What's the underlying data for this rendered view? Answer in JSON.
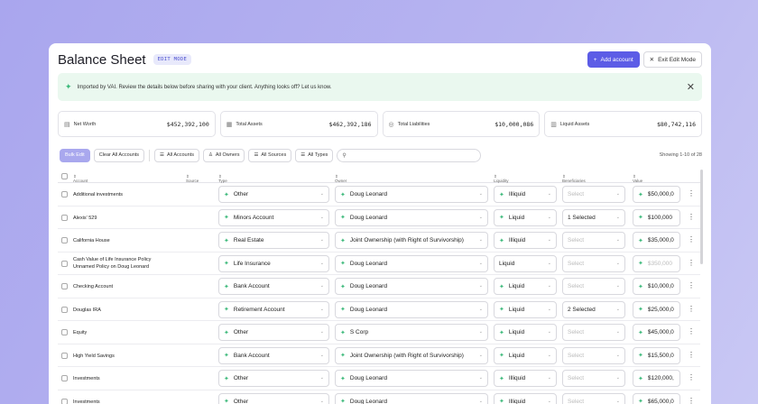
{
  "header": {
    "title": "Balance Sheet",
    "mode_badge": "EDIT MODE",
    "add_account_label": "Add account",
    "exit_edit_label": "Exit Edit Mode"
  },
  "banner": {
    "message": "Imported by VAI. Review the details below before sharing with your client. Anything looks off? Let us know."
  },
  "stats": [
    {
      "label": "Net Worth",
      "value": "$452,392,100"
    },
    {
      "label": "Total Assets",
      "value": "$462,392,186"
    },
    {
      "label": "Total Liabilities",
      "value": "$10,000,086"
    },
    {
      "label": "Liquid Assets",
      "value": "$80,742,116"
    }
  ],
  "filters": {
    "bulk_edit": "Bulk Edit",
    "clear_all": "Clear All Accounts",
    "all_accounts": "All Accounts",
    "all_owners": "All Owners",
    "all_sources": "All Sources",
    "all_types": "All Types",
    "showing": "Showing 1-10 of 28"
  },
  "columns": {
    "account": "Account",
    "source": "Source",
    "type": "Type",
    "owner": "Owner",
    "liquidity": "Liquidity",
    "beneficiaries": "Beneficiaries",
    "value": "Value"
  },
  "rows": [
    {
      "account": "Additional investments",
      "account2": "",
      "type": "Other",
      "owner": "Doug Leonard",
      "liquidity": "Illiquid",
      "beneficiaries": "Select",
      "value": "$50,000,0"
    },
    {
      "account": "Alexis' 529",
      "account2": "",
      "type": "Minors Account",
      "owner": "Doug Leonard",
      "liquidity": "Liquid",
      "beneficiaries": "1 Selected",
      "value": "$100,000"
    },
    {
      "account": "California House",
      "account2": "",
      "type": "Real Estate",
      "owner": "Joint Ownership (with Right of Survivorship)",
      "liquidity": "Illiquid",
      "beneficiaries": "Select",
      "value": "$35,000,0"
    },
    {
      "account": "Cash Value of Life Insurance Policy",
      "account2": "Unnamed Policy on Doug Leonard",
      "type": "Life Insurance",
      "owner": "Doug Leonard",
      "liquidity": "Liquid",
      "beneficiaries": "Select",
      "value": "$350,000"
    },
    {
      "account": "Checking Account",
      "account2": "",
      "type": "Bank Account",
      "owner": "Doug Leonard",
      "liquidity": "Liquid",
      "beneficiaries": "Select",
      "value": "$10,000,0"
    },
    {
      "account": "Douglas IRA",
      "account2": "",
      "type": "Retirement Account",
      "owner": "Doug Leonard",
      "liquidity": "Liquid",
      "beneficiaries": "2 Selected",
      "value": "$25,000,0"
    },
    {
      "account": "Equity",
      "account2": "",
      "type": "Other",
      "owner": "S Corp",
      "liquidity": "Liquid",
      "beneficiaries": "Select",
      "value": "$45,000,0"
    },
    {
      "account": "High Yield Savings",
      "account2": "",
      "type": "Bank Account",
      "owner": "Joint Ownership (with Right of Survivorship)",
      "liquidity": "Liquid",
      "beneficiaries": "Select",
      "value": "$15,500,0"
    },
    {
      "account": "Investments",
      "account2": "",
      "type": "Other",
      "owner": "Doug Leonard",
      "liquidity": "Illiquid",
      "beneficiaries": "Select",
      "value": "$120,000,"
    },
    {
      "account": "Investments",
      "account2": "",
      "type": "Other",
      "owner": "Doug Leonard",
      "liquidity": "Illiquid",
      "beneficiaries": "Select",
      "value": "$65,000,0"
    }
  ],
  "colors": {
    "accent": "#5c5ce6",
    "sparkle": "#3cb97a",
    "banner_bg": "#eaf8ef"
  },
  "icons": {
    "sparkle": "sparkle-icon",
    "kebab": "kebab-menu-icon"
  }
}
